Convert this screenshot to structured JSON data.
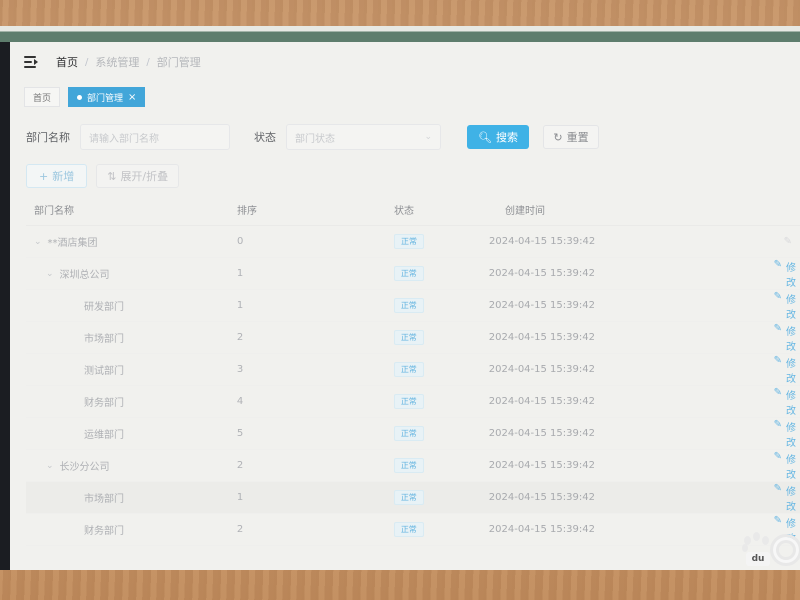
{
  "breadcrumb": [
    "首页",
    "系统管理",
    "部门管理"
  ],
  "tabs": [
    {
      "label": "首页",
      "active": false
    },
    {
      "label": "部门管理",
      "active": true,
      "close": "×"
    }
  ],
  "search": {
    "dept_name_label": "部门名称",
    "dept_name_placeholder": "请输入部门名称",
    "status_label": "状态",
    "status_placeholder": "部门状态",
    "search_button": "搜索",
    "reset_button": "重置"
  },
  "actions": {
    "add_button": "新增",
    "expand_button": "展开/折叠"
  },
  "table": {
    "headers": {
      "name": "部门名称",
      "order": "排序",
      "status": "状态",
      "created": "创建时间"
    },
    "rows": [
      {
        "name": "**酒店集团",
        "order": "0",
        "status": "正常",
        "created": "2024-04-15 15:39:42",
        "op": "修改"
      },
      {
        "name": "深圳总公司",
        "order": "1",
        "status": "正常",
        "created": "2024-04-15 15:39:42",
        "op": "修改"
      },
      {
        "name": "研发部门",
        "order": "1",
        "status": "正常",
        "created": "2024-04-15 15:39:42",
        "op": "修改"
      },
      {
        "name": "市场部门",
        "order": "2",
        "status": "正常",
        "created": "2024-04-15 15:39:42",
        "op": "修改"
      },
      {
        "name": "测试部门",
        "order": "3",
        "status": "正常",
        "created": "2024-04-15 15:39:42",
        "op": "修改"
      },
      {
        "name": "财务部门",
        "order": "4",
        "status": "正常",
        "created": "2024-04-15 15:39:42",
        "op": "修改"
      },
      {
        "name": "运维部门",
        "order": "5",
        "status": "正常",
        "created": "2024-04-15 15:39:42",
        "op": "修改"
      },
      {
        "name": "长沙分公司",
        "order": "2",
        "status": "正常",
        "created": "2024-04-15 15:39:42",
        "op": "修改"
      },
      {
        "name": "市场部门",
        "order": "1",
        "status": "正常",
        "created": "2024-04-15 15:39:42",
        "op": "修改"
      },
      {
        "name": "财务部门",
        "order": "2",
        "status": "正常",
        "created": "2024-04-15 15:39:42",
        "op": "修改"
      }
    ]
  },
  "watermark": {
    "text": "du"
  },
  "colors": {
    "primary": "#3fb2e6",
    "tag_active": "#42a6d9",
    "link": "#65b6e3"
  }
}
